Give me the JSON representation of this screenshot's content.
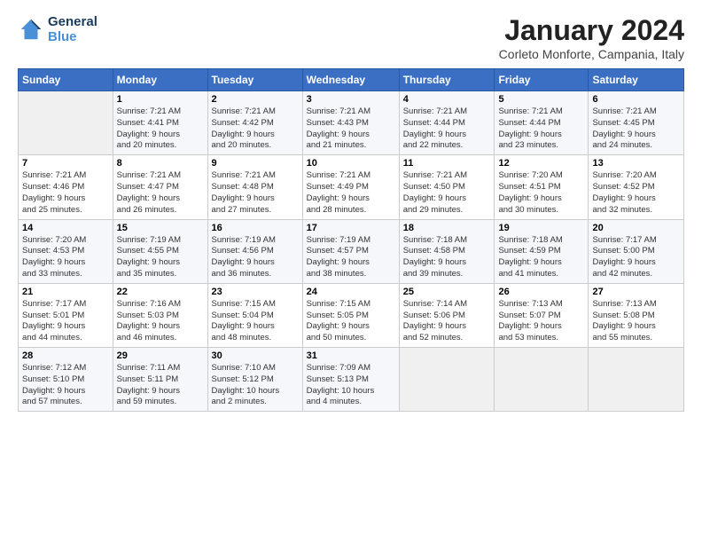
{
  "logo": {
    "line1": "General",
    "line2": "Blue"
  },
  "title": "January 2024",
  "subtitle": "Corleto Monforte, Campania, Italy",
  "days_of_week": [
    "Sunday",
    "Monday",
    "Tuesday",
    "Wednesday",
    "Thursday",
    "Friday",
    "Saturday"
  ],
  "weeks": [
    [
      {
        "day": "",
        "info": ""
      },
      {
        "day": "1",
        "info": "Sunrise: 7:21 AM\nSunset: 4:41 PM\nDaylight: 9 hours\nand 20 minutes."
      },
      {
        "day": "2",
        "info": "Sunrise: 7:21 AM\nSunset: 4:42 PM\nDaylight: 9 hours\nand 20 minutes."
      },
      {
        "day": "3",
        "info": "Sunrise: 7:21 AM\nSunset: 4:43 PM\nDaylight: 9 hours\nand 21 minutes."
      },
      {
        "day": "4",
        "info": "Sunrise: 7:21 AM\nSunset: 4:44 PM\nDaylight: 9 hours\nand 22 minutes."
      },
      {
        "day": "5",
        "info": "Sunrise: 7:21 AM\nSunset: 4:44 PM\nDaylight: 9 hours\nand 23 minutes."
      },
      {
        "day": "6",
        "info": "Sunrise: 7:21 AM\nSunset: 4:45 PM\nDaylight: 9 hours\nand 24 minutes."
      }
    ],
    [
      {
        "day": "7",
        "info": "Sunrise: 7:21 AM\nSunset: 4:46 PM\nDaylight: 9 hours\nand 25 minutes."
      },
      {
        "day": "8",
        "info": "Sunrise: 7:21 AM\nSunset: 4:47 PM\nDaylight: 9 hours\nand 26 minutes."
      },
      {
        "day": "9",
        "info": "Sunrise: 7:21 AM\nSunset: 4:48 PM\nDaylight: 9 hours\nand 27 minutes."
      },
      {
        "day": "10",
        "info": "Sunrise: 7:21 AM\nSunset: 4:49 PM\nDaylight: 9 hours\nand 28 minutes."
      },
      {
        "day": "11",
        "info": "Sunrise: 7:21 AM\nSunset: 4:50 PM\nDaylight: 9 hours\nand 29 minutes."
      },
      {
        "day": "12",
        "info": "Sunrise: 7:20 AM\nSunset: 4:51 PM\nDaylight: 9 hours\nand 30 minutes."
      },
      {
        "day": "13",
        "info": "Sunrise: 7:20 AM\nSunset: 4:52 PM\nDaylight: 9 hours\nand 32 minutes."
      }
    ],
    [
      {
        "day": "14",
        "info": "Sunrise: 7:20 AM\nSunset: 4:53 PM\nDaylight: 9 hours\nand 33 minutes."
      },
      {
        "day": "15",
        "info": "Sunrise: 7:19 AM\nSunset: 4:55 PM\nDaylight: 9 hours\nand 35 minutes."
      },
      {
        "day": "16",
        "info": "Sunrise: 7:19 AM\nSunset: 4:56 PM\nDaylight: 9 hours\nand 36 minutes."
      },
      {
        "day": "17",
        "info": "Sunrise: 7:19 AM\nSunset: 4:57 PM\nDaylight: 9 hours\nand 38 minutes."
      },
      {
        "day": "18",
        "info": "Sunrise: 7:18 AM\nSunset: 4:58 PM\nDaylight: 9 hours\nand 39 minutes."
      },
      {
        "day": "19",
        "info": "Sunrise: 7:18 AM\nSunset: 4:59 PM\nDaylight: 9 hours\nand 41 minutes."
      },
      {
        "day": "20",
        "info": "Sunrise: 7:17 AM\nSunset: 5:00 PM\nDaylight: 9 hours\nand 42 minutes."
      }
    ],
    [
      {
        "day": "21",
        "info": "Sunrise: 7:17 AM\nSunset: 5:01 PM\nDaylight: 9 hours\nand 44 minutes."
      },
      {
        "day": "22",
        "info": "Sunrise: 7:16 AM\nSunset: 5:03 PM\nDaylight: 9 hours\nand 46 minutes."
      },
      {
        "day": "23",
        "info": "Sunrise: 7:15 AM\nSunset: 5:04 PM\nDaylight: 9 hours\nand 48 minutes."
      },
      {
        "day": "24",
        "info": "Sunrise: 7:15 AM\nSunset: 5:05 PM\nDaylight: 9 hours\nand 50 minutes."
      },
      {
        "day": "25",
        "info": "Sunrise: 7:14 AM\nSunset: 5:06 PM\nDaylight: 9 hours\nand 52 minutes."
      },
      {
        "day": "26",
        "info": "Sunrise: 7:13 AM\nSunset: 5:07 PM\nDaylight: 9 hours\nand 53 minutes."
      },
      {
        "day": "27",
        "info": "Sunrise: 7:13 AM\nSunset: 5:08 PM\nDaylight: 9 hours\nand 55 minutes."
      }
    ],
    [
      {
        "day": "28",
        "info": "Sunrise: 7:12 AM\nSunset: 5:10 PM\nDaylight: 9 hours\nand 57 minutes."
      },
      {
        "day": "29",
        "info": "Sunrise: 7:11 AM\nSunset: 5:11 PM\nDaylight: 9 hours\nand 59 minutes."
      },
      {
        "day": "30",
        "info": "Sunrise: 7:10 AM\nSunset: 5:12 PM\nDaylight: 10 hours\nand 2 minutes."
      },
      {
        "day": "31",
        "info": "Sunrise: 7:09 AM\nSunset: 5:13 PM\nDaylight: 10 hours\nand 4 minutes."
      },
      {
        "day": "",
        "info": ""
      },
      {
        "day": "",
        "info": ""
      },
      {
        "day": "",
        "info": ""
      }
    ]
  ]
}
